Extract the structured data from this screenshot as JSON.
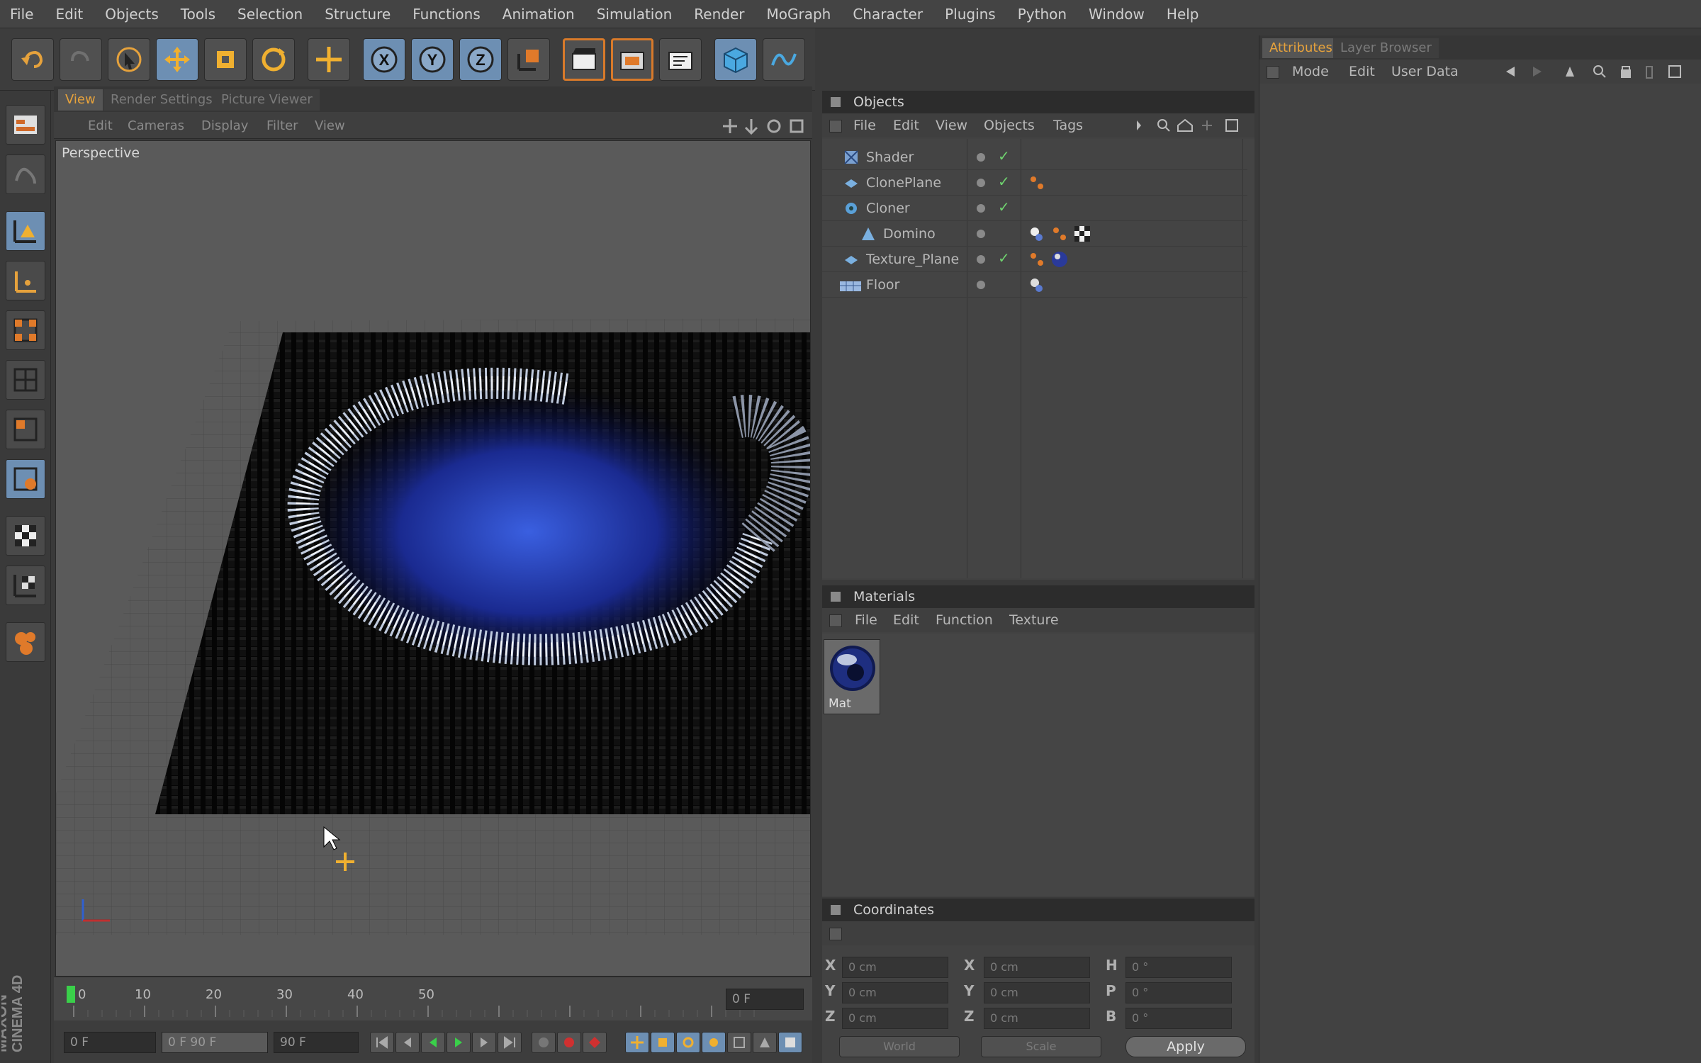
{
  "app": {
    "brand_line1": "MAXON",
    "brand_line2": "CINEMA 4D"
  },
  "menubar": [
    "File",
    "Edit",
    "Objects",
    "Tools",
    "Selection",
    "Structure",
    "Functions",
    "Animation",
    "Simulation",
    "Render",
    "MoGraph",
    "Character",
    "Plugins",
    "Python",
    "Window",
    "Help"
  ],
  "toolbar": {
    "icons": [
      "undo-icon",
      "redo-icon",
      "live-selection-icon",
      "move-icon",
      "scale-icon",
      "rotate-icon",
      "world-axis-icon",
      "x-axis-lock-icon",
      "y-axis-lock-icon",
      "z-axis-lock-icon",
      "coordinate-system-icon",
      "render-view-icon",
      "render-to-picture-viewer-icon",
      "edit-render-settings-icon",
      "cube-primitive-icon",
      "spline-icon"
    ],
    "x_label": "X",
    "y_label": "Y",
    "z_label": "Z"
  },
  "palette": {
    "icons": [
      "layout-icon",
      "sculpt-icon",
      "model-mode-icon",
      "object-axis-icon",
      "points-mode-icon",
      "edges-mode-icon",
      "polygons-mode-icon",
      "uvw-mode-icon",
      "checker-icon",
      "texture-axis-icon",
      "snap-icon"
    ]
  },
  "viewport": {
    "tabs": [
      "View",
      "Render Settings",
      "Picture Viewer"
    ],
    "active_tab": "View",
    "menu": [
      "Edit",
      "Cameras",
      "Display",
      "Filter",
      "View"
    ],
    "label": "Perspective"
  },
  "timeline": {
    "ticks": [
      "0",
      "10",
      "20",
      "30",
      "40",
      "50"
    ],
    "current_frame": "0 F",
    "start_field": "0 F",
    "range_field": "0 F   90 F",
    "end_field": "90 F"
  },
  "objects_panel": {
    "title": "Objects",
    "menu": [
      "File",
      "Edit",
      "View",
      "Objects",
      "Tags"
    ],
    "items": [
      {
        "name": "Shader",
        "icon": "shader-effector-icon",
        "indent": 0
      },
      {
        "name": "ClonePlane",
        "icon": "plane-icon",
        "indent": 0
      },
      {
        "name": "Cloner",
        "icon": "cloner-icon",
        "indent": 0
      },
      {
        "name": "Domino",
        "icon": "domino-icon",
        "indent": 1
      },
      {
        "name": "Texture_Plane",
        "icon": "plane-icon",
        "indent": 0
      },
      {
        "name": "Floor",
        "icon": "floor-icon",
        "indent": 0
      }
    ]
  },
  "materials_panel": {
    "title": "Materials",
    "menu": [
      "File",
      "Edit",
      "Function",
      "Texture"
    ],
    "materials": [
      {
        "name": "Mat"
      }
    ]
  },
  "coordinates_panel": {
    "title": "Coordinates",
    "rows": [
      {
        "axis": "X",
        "pos": "0 cm",
        "size_axis": "X",
        "size": "0 cm",
        "rot_axis": "H",
        "rot": "0 °"
      },
      {
        "axis": "Y",
        "pos": "0 cm",
        "size_axis": "Y",
        "size": "0 cm",
        "rot_axis": "P",
        "rot": "0 °"
      },
      {
        "axis": "Z",
        "pos": "0 cm",
        "size_axis": "Z",
        "size": "0 cm",
        "rot_axis": "B",
        "rot": "0 °"
      }
    ],
    "mode_select": "World",
    "size_select": "Scale",
    "apply_label": "Apply"
  },
  "attributes_panel": {
    "tabs": [
      "Attributes",
      "Layer Browser"
    ],
    "active_tab": "Attributes",
    "menu": [
      "Mode",
      "Edit",
      "User Data"
    ]
  },
  "colors": {
    "accent_orange": "#e6a23c",
    "active_blue": "#6d8fb3",
    "panel_bg": "#424242"
  }
}
